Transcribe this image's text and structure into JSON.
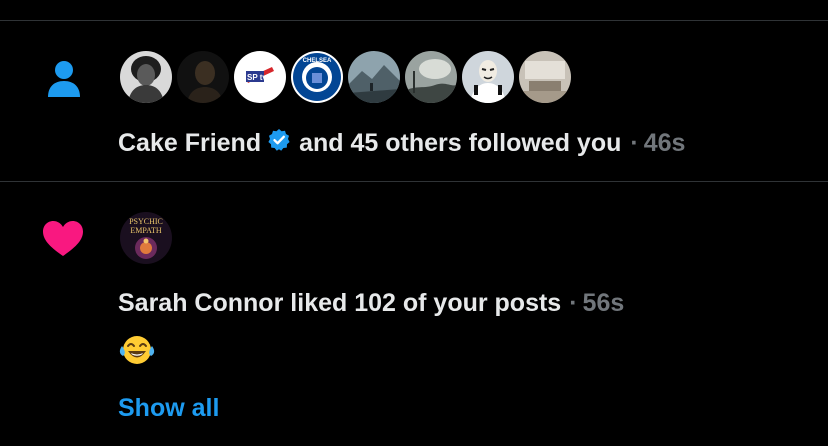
{
  "icons": {
    "follow": "person-icon",
    "like": "heart-icon",
    "verified": "verified-badge-icon",
    "emoji": "tears-of-joy-emoji"
  },
  "colors": {
    "background": "#000000",
    "text": "#e7e9ea",
    "muted": "#71767b",
    "accent": "#1d9bf0",
    "like": "#f91880",
    "divider": "#2f3336"
  },
  "follow_notification": {
    "actor": "Cake Friend",
    "text": "and 45 others followed you",
    "separator": "·",
    "time": "46s",
    "avatars": [
      {
        "name": "avatar-portrait-woman"
      },
      {
        "name": "avatar-dark-portrait"
      },
      {
        "name": "avatar-sptv-logo",
        "label": "SP tv"
      },
      {
        "name": "avatar-chelsea-crest",
        "label": "CHELSEA"
      },
      {
        "name": "avatar-mountain-landscape"
      },
      {
        "name": "avatar-cloudy-sky"
      },
      {
        "name": "avatar-masked-person"
      },
      {
        "name": "avatar-room-interior"
      }
    ]
  },
  "like_notification": {
    "actor": "Sarah Connor",
    "text": "liked 102 of your posts",
    "separator": "·",
    "time": "56s",
    "avatar_label_1": "PSYCHIC",
    "avatar_label_2": "EMPATH",
    "emoji": "😂",
    "show_all": "Show all"
  }
}
